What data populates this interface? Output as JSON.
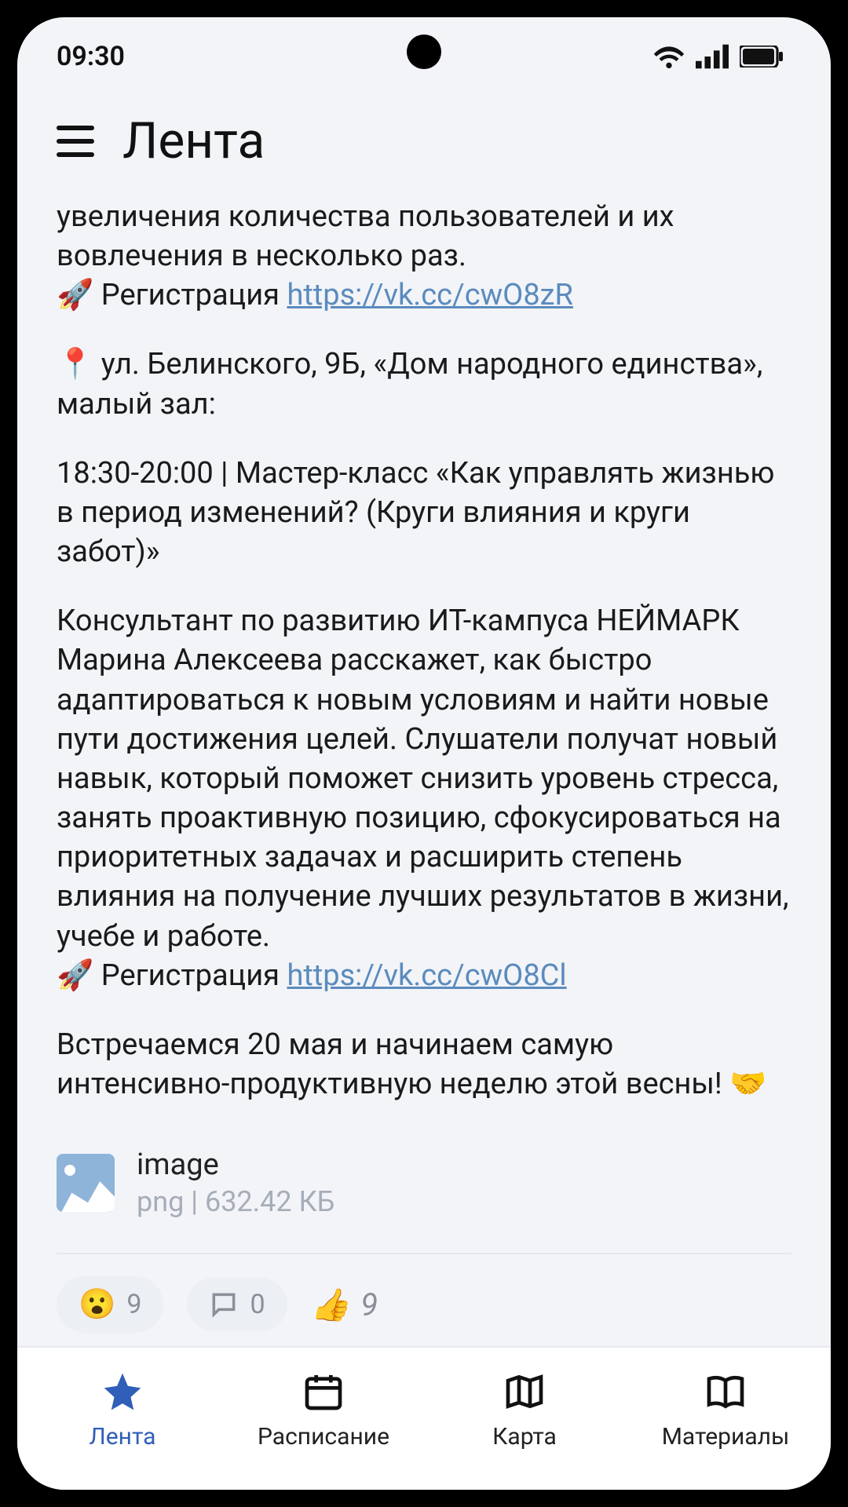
{
  "status": {
    "time": "09:30"
  },
  "header": {
    "title": "Лента"
  },
  "post": {
    "line1": "увеличения количества пользователей и их вовлечения в несколько раз.",
    "reg1_prefix": "🚀 Регистрация ",
    "reg1_link": "https://vk.cc/cwO8zR",
    "loc_line": "📍 ул. Белинского, 9Б, «Дом народного единства», малый зал:",
    "event_line": "18:30-20:00 | Мастер-класс «Как управлять жизнью в период изменений? (Круги влияния и круги забот)»",
    "body": "Консультант по развитию ИТ-кампуса НЕЙМАРК Марина Алексеева расскажет, как быстро адаптироваться к новым условиям и найти новые пути достижения целей. Слушатели получат новый навык, который поможет снизить уровень стресса, занять проактивную позицию, сфокусироваться на приоритетных задачах и расширить степень влияния на получение лучших результатов в жизни, учебе и работе.",
    "reg2_prefix": "🚀 Регистрация ",
    "reg2_link": "https://vk.cc/cwO8Cl",
    "closing": "Встречаемся 20 мая и начинаем самую интенсивно-продуктивную неделю этой весны! 🤝"
  },
  "attachment": {
    "title": "image",
    "subtitle": "png | 632.42 КБ"
  },
  "reactions": {
    "surprise_emoji": "😮",
    "surprise_count": "9",
    "comment_count": "0",
    "like_emoji": "👍",
    "like_count": "9"
  },
  "nav": {
    "feed": "Лента",
    "schedule": "Расписание",
    "map": "Карта",
    "materials": "Материалы"
  }
}
